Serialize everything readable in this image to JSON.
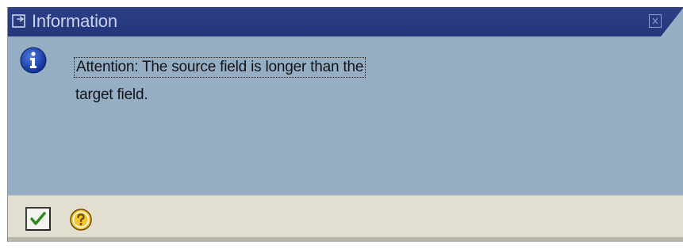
{
  "window": {
    "title": "Information"
  },
  "message": {
    "line1": "Attention: The source field is longer than the",
    "line2": "target field."
  },
  "icons": {
    "title": "popup-window-icon",
    "close": "close-icon",
    "info": "info-icon",
    "ok": "checkmark-icon",
    "help": "help-icon"
  },
  "colors": {
    "title_bar": "#2c3f86",
    "content_bg": "#95aec3",
    "footer_bg": "#e2ded0",
    "info_icon": "#1a3fa8",
    "ok_check": "#2c8a1e",
    "help_icon": "#f0c020"
  }
}
